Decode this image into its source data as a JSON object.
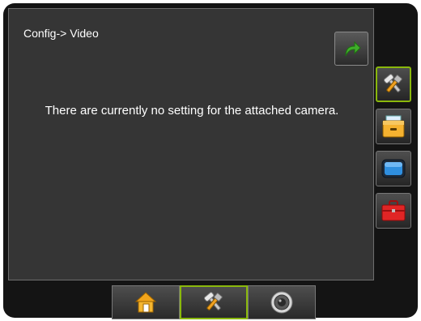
{
  "screen": {
    "title": "Config-> Video",
    "message": "There are currently no setting for the attached camera."
  },
  "icons": {
    "back": "return-arrow-icon",
    "side": [
      "tools-icon",
      "file-drawer-icon",
      "display-icon",
      "toolbox-icon"
    ],
    "bottom": [
      "home-icon",
      "tools-icon",
      "camera-icon"
    ]
  },
  "colors": {
    "accent_active": "#8ab80c",
    "arrow_green": "#3fae2a",
    "panel": "#353535",
    "frame": "#141414"
  }
}
